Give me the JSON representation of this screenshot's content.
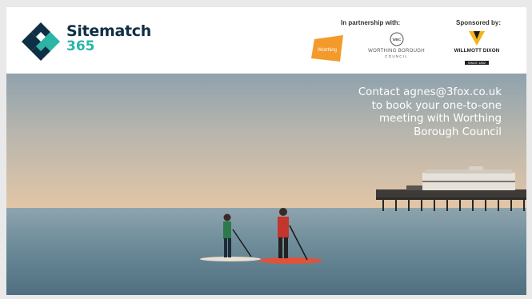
{
  "brand": {
    "name": "Sitematch",
    "number": "365"
  },
  "partners": {
    "heading": "In partnership with:",
    "worthing_badge": "Worthing",
    "council_seal": "WBC",
    "council_name": "WORTHING BOROUGH",
    "council_sub": "COUNCIL"
  },
  "sponsor": {
    "heading": "Sponsored by:",
    "name": "WILLMOTT DIXON",
    "tagline": "SINCE 1852"
  },
  "cta": {
    "line1": "Contact agnes@3fox.co.uk",
    "line2": "to book your one-to-one",
    "line3": "meeting with Worthing",
    "line4": "Borough Council"
  },
  "colors": {
    "navy": "#0f2f45",
    "teal": "#2bb5a7",
    "orange": "#f39a2b",
    "gold": "#f2b31b"
  }
}
